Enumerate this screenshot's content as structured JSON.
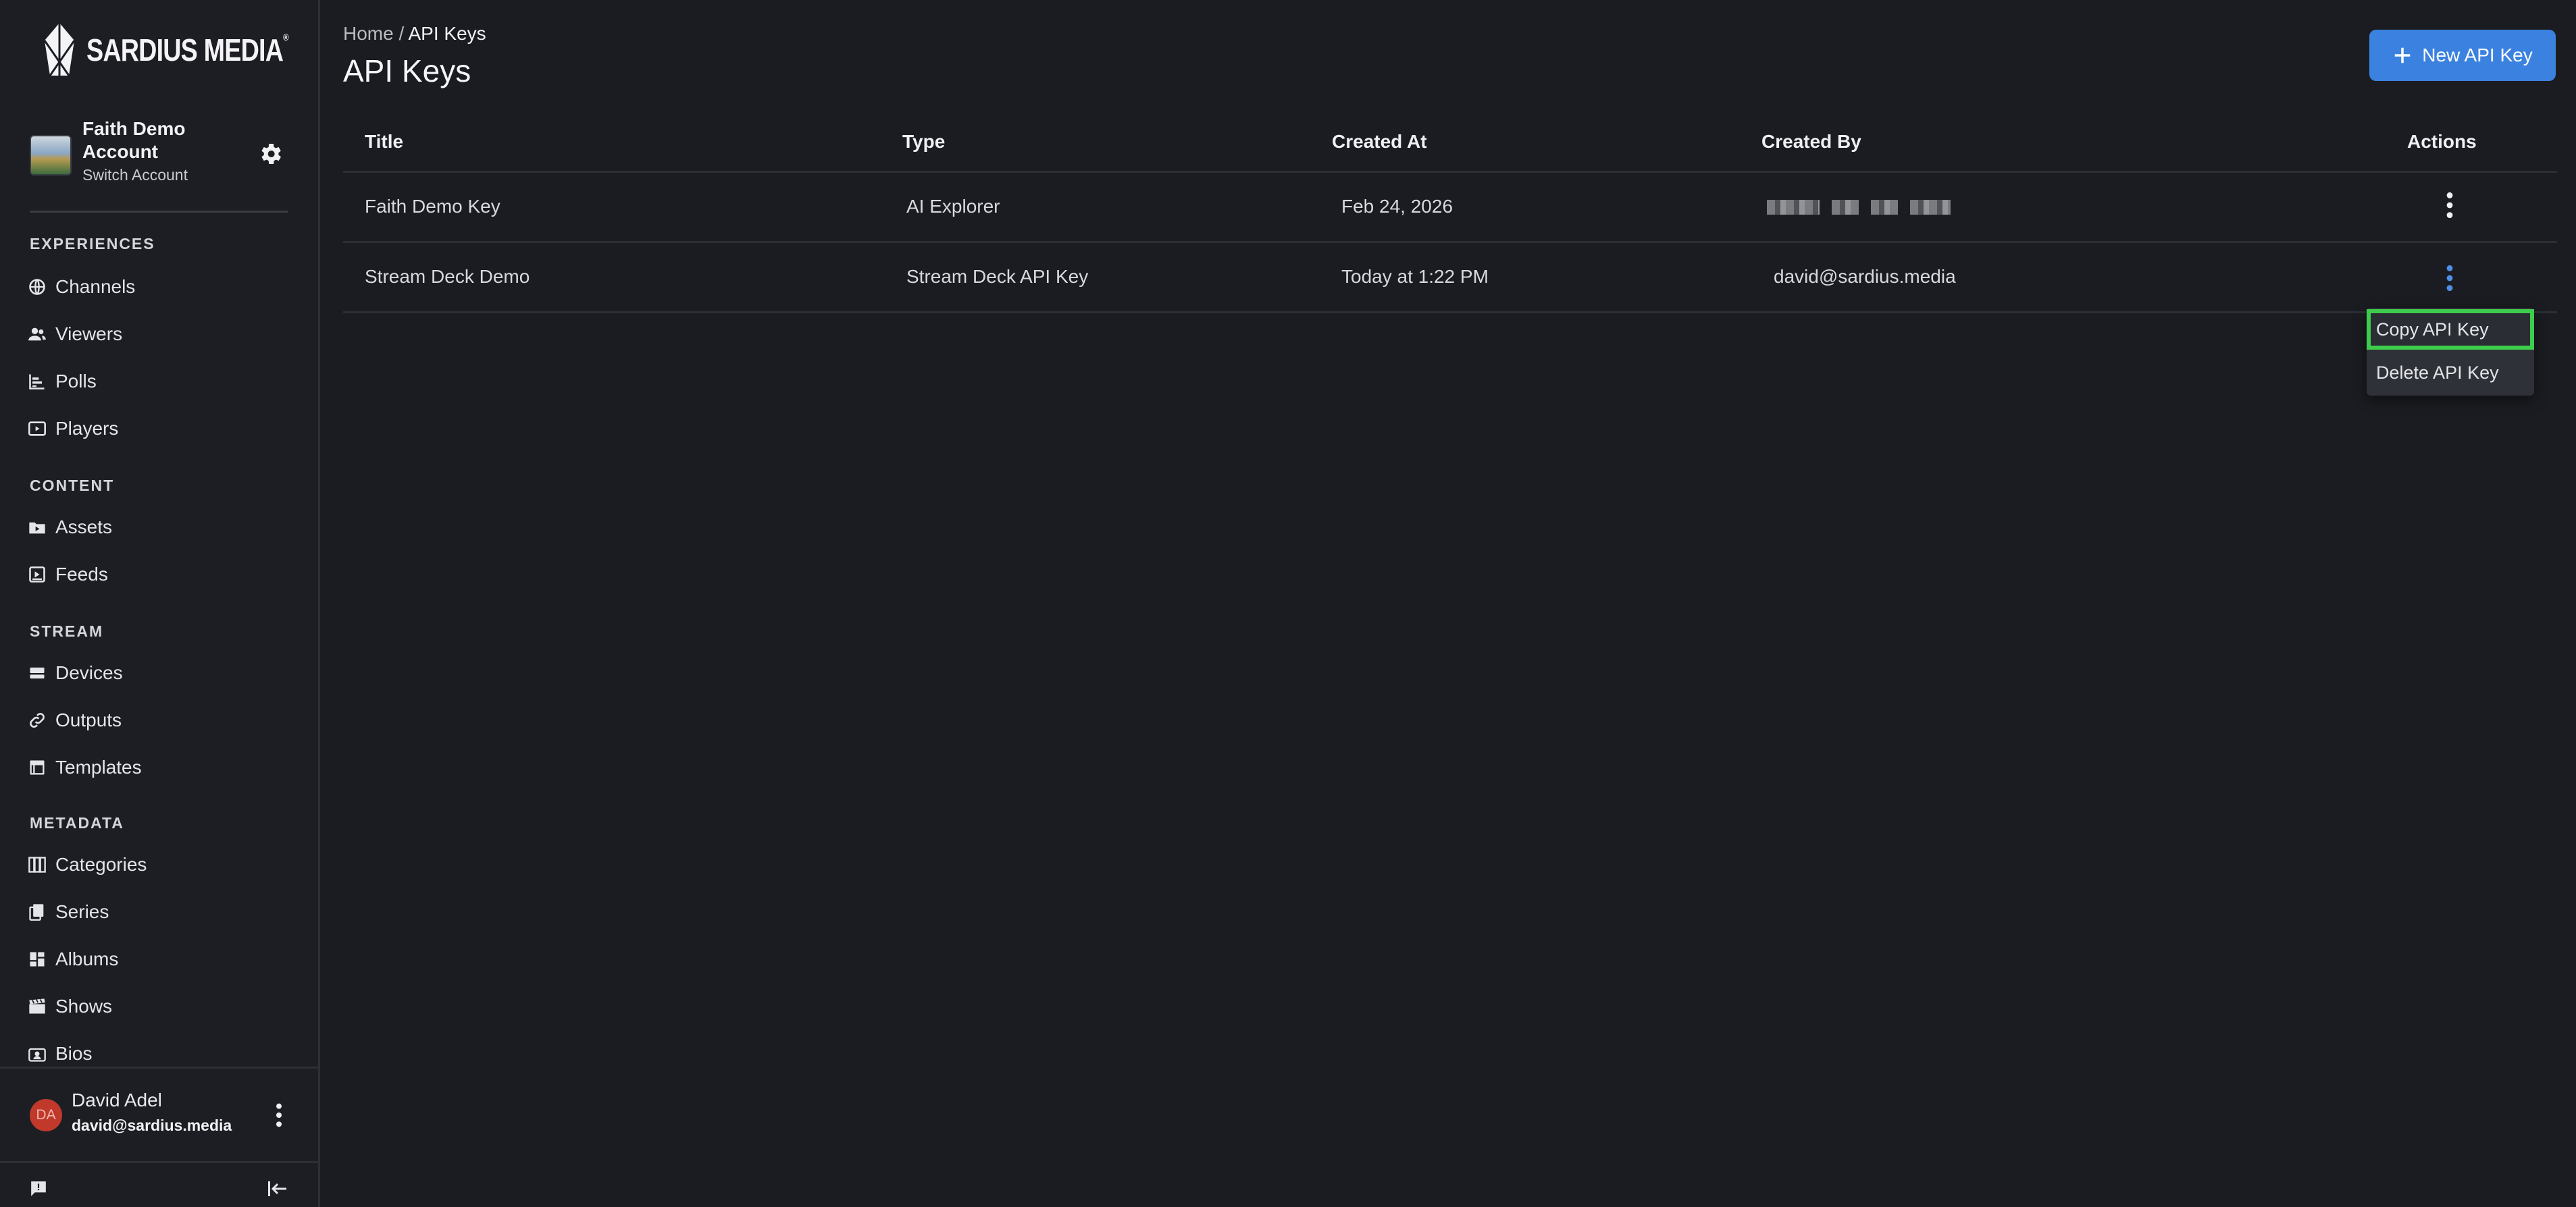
{
  "brand": {
    "name": "SARDIUS MEDIA",
    "trademark": "®"
  },
  "account": {
    "name": "Faith Demo Account",
    "switch_label": "Switch Account"
  },
  "sidebar": {
    "sections": [
      {
        "label": "EXPERIENCES",
        "items": [
          {
            "label": "Channels",
            "icon": "globe-icon"
          },
          {
            "label": "Viewers",
            "icon": "users-icon"
          },
          {
            "label": "Polls",
            "icon": "bar-chart-icon"
          },
          {
            "label": "Players",
            "icon": "play-icon"
          }
        ]
      },
      {
        "label": "CONTENT",
        "items": [
          {
            "label": "Assets",
            "icon": "folder-play-icon"
          },
          {
            "label": "Feeds",
            "icon": "feed-icon"
          }
        ]
      },
      {
        "label": "STREAM",
        "items": [
          {
            "label": "Devices",
            "icon": "server-icon"
          },
          {
            "label": "Outputs",
            "icon": "link-icon"
          },
          {
            "label": "Templates",
            "icon": "template-icon"
          }
        ]
      },
      {
        "label": "METADATA",
        "items": [
          {
            "label": "Categories",
            "icon": "grid-icon"
          },
          {
            "label": "Series",
            "icon": "stack-icon"
          },
          {
            "label": "Albums",
            "icon": "dashboard-icon"
          },
          {
            "label": "Shows",
            "icon": "clapper-icon"
          },
          {
            "label": "Bios",
            "icon": "id-badge-icon"
          }
        ]
      }
    ]
  },
  "user": {
    "initials": "DA",
    "name": "David Adel",
    "email": "david@sardius.media"
  },
  "header": {
    "breadcrumb_home": "Home",
    "breadcrumb_sep": "/",
    "breadcrumb_current": "API Keys",
    "title": "API Keys",
    "new_button_label": "New API Key"
  },
  "table": {
    "columns": {
      "title": "Title",
      "type": "Type",
      "created_at": "Created At",
      "created_by": "Created By",
      "actions": "Actions"
    },
    "rows": [
      {
        "title": "Faith Demo Key",
        "type": "AI Explorer",
        "created_at": "Feb 24, 2026",
        "created_by": ""
      },
      {
        "title": "Stream Deck Demo",
        "type": "Stream Deck API Key",
        "created_at": "Today at 1:22 PM",
        "created_by": "david@sardius.media"
      }
    ]
  },
  "context_menu": {
    "copy_label": "Copy API Key",
    "delete_label": "Delete API Key"
  },
  "colors": {
    "accent": "#3b82e0",
    "highlight": "#3ecc4c",
    "avatar": "#c0392b",
    "background": "#1a1c21"
  }
}
